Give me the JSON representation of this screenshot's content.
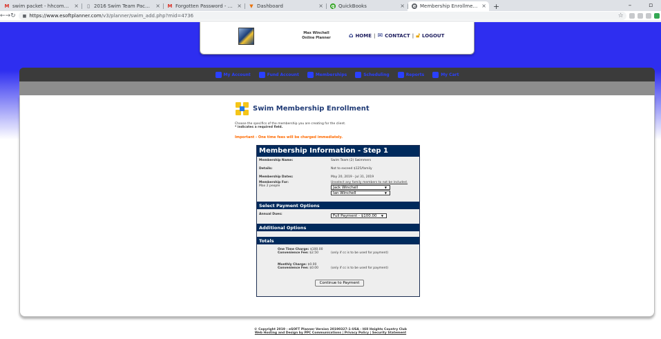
{
  "browser": {
    "tabs": [
      {
        "icon": "gmail-icon",
        "title": "swim packet - hhcomoney@gmai"
      },
      {
        "icon": "docs-icon",
        "title": "2016 Swim Team Packet"
      },
      {
        "icon": "gmail-icon",
        "title": "Forgotten Password - Hill Height"
      },
      {
        "icon": "fox-icon",
        "title": "Dashboard"
      },
      {
        "icon": "quickbooks-icon",
        "title": "QuickBooks"
      },
      {
        "icon": "esoft-icon",
        "title": "Membership Enrollment - eSoft"
      }
    ],
    "url_host": "https://www.esoftplanner.com",
    "url_path": "/v3/planner/swim_add.php?mid=4736"
  },
  "header": {
    "user_name": "Max Winchell",
    "user_role": "Online Planner",
    "home": "HOME",
    "contact": "CONTACT",
    "logout": "LOGOUT",
    "sep": "|"
  },
  "nav": [
    "My Account",
    "Fund Account",
    "Memberships",
    "Scheduling",
    "Reports",
    "My Cart"
  ],
  "page": {
    "title": "Swim Membership Enrollment",
    "intro": "Choose the specifics of the membership you are creating for the client.",
    "required": "* indicates a required field.",
    "important": "Important - One time fees will be charged immediately."
  },
  "form": {
    "step_title": "Membership Information - Step 1",
    "name_label": "Membership Name:",
    "name_value": "Swim Team (2) Swimmers",
    "details_label": "Details:",
    "details_value": "Not to exceed $125/family",
    "dates_label": "Membership Dates:",
    "dates_value": "May 20, 2019 - Jul 31, 2019",
    "for_label": "Membership For:",
    "for_max": "Max 2 people",
    "for_note": "Unselect any family members to not be included.",
    "member1": "Jack Winchell",
    "member2": "Ian Winchell",
    "payment_header": "Select Payment Options",
    "dues_label": "Annual Dues:",
    "dues_value": "Full Payment - $100.00",
    "additional_header": "Additional Options",
    "totals_header": "Totals",
    "one_time_label": "One Time Charge:",
    "one_time_value": "$100.00",
    "conv1_label": "Convenience Fee:",
    "conv1_value": "$2.50",
    "conv1_note": "(only if cc is to be used for payment)",
    "monthly_label": "Monthly Charge:",
    "monthly_value": "$0.00",
    "conv2_label": "Convenience Fee:",
    "conv2_value": "$0.00",
    "conv2_note": "(only if cc is to be used for payment)",
    "continue": "Continue to Payment"
  },
  "footer": {
    "line1": "© Copyright 2019 - eSOFT Planner Version 20190327-1-USA - Hill Heights Country Club",
    "line2": "Web Hosting and Design by PPC Communications | Privacy Policy | Security Statement"
  }
}
